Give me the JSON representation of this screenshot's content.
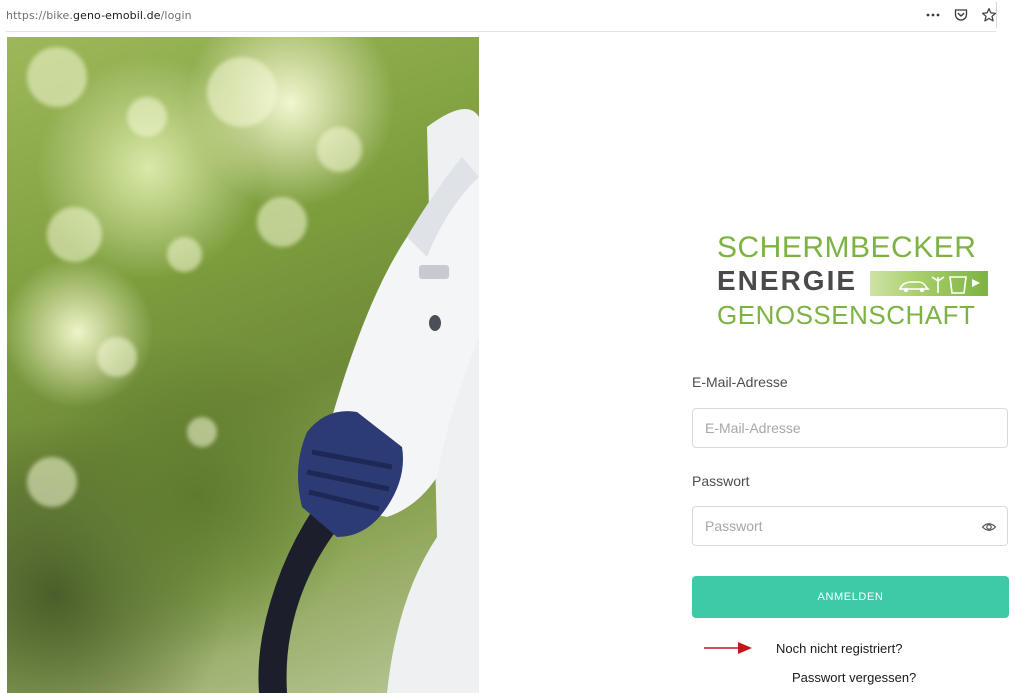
{
  "browser": {
    "url_prefix": "https://bike.",
    "url_host": "geno-emobil.de",
    "url_path": "/login",
    "more_icon": "more-dots-icon",
    "pocket_icon": "pocket-icon",
    "bookmark_icon": "star-icon"
  },
  "logo": {
    "line1": "SCHERMBECKER",
    "line2": "ENERGIE",
    "line3": "GENOSSENSCHAFT",
    "colors": {
      "green": "#7cb342",
      "gray": "#4a4a4a"
    }
  },
  "form": {
    "email_label": "E-Mail-Adresse",
    "email_placeholder": "E-Mail-Adresse",
    "email_value": "",
    "password_label": "Passwort",
    "password_placeholder": "Passwort",
    "password_value": "",
    "show_password_icon": "eye-icon",
    "submit_label": "ANMELDEN",
    "submit_color": "#3ec9a7"
  },
  "links": {
    "register": "Noch nicht registriert?",
    "forgot": "Passwort vergessen?"
  },
  "annotation": {
    "arrow_color": "#c0171b"
  }
}
